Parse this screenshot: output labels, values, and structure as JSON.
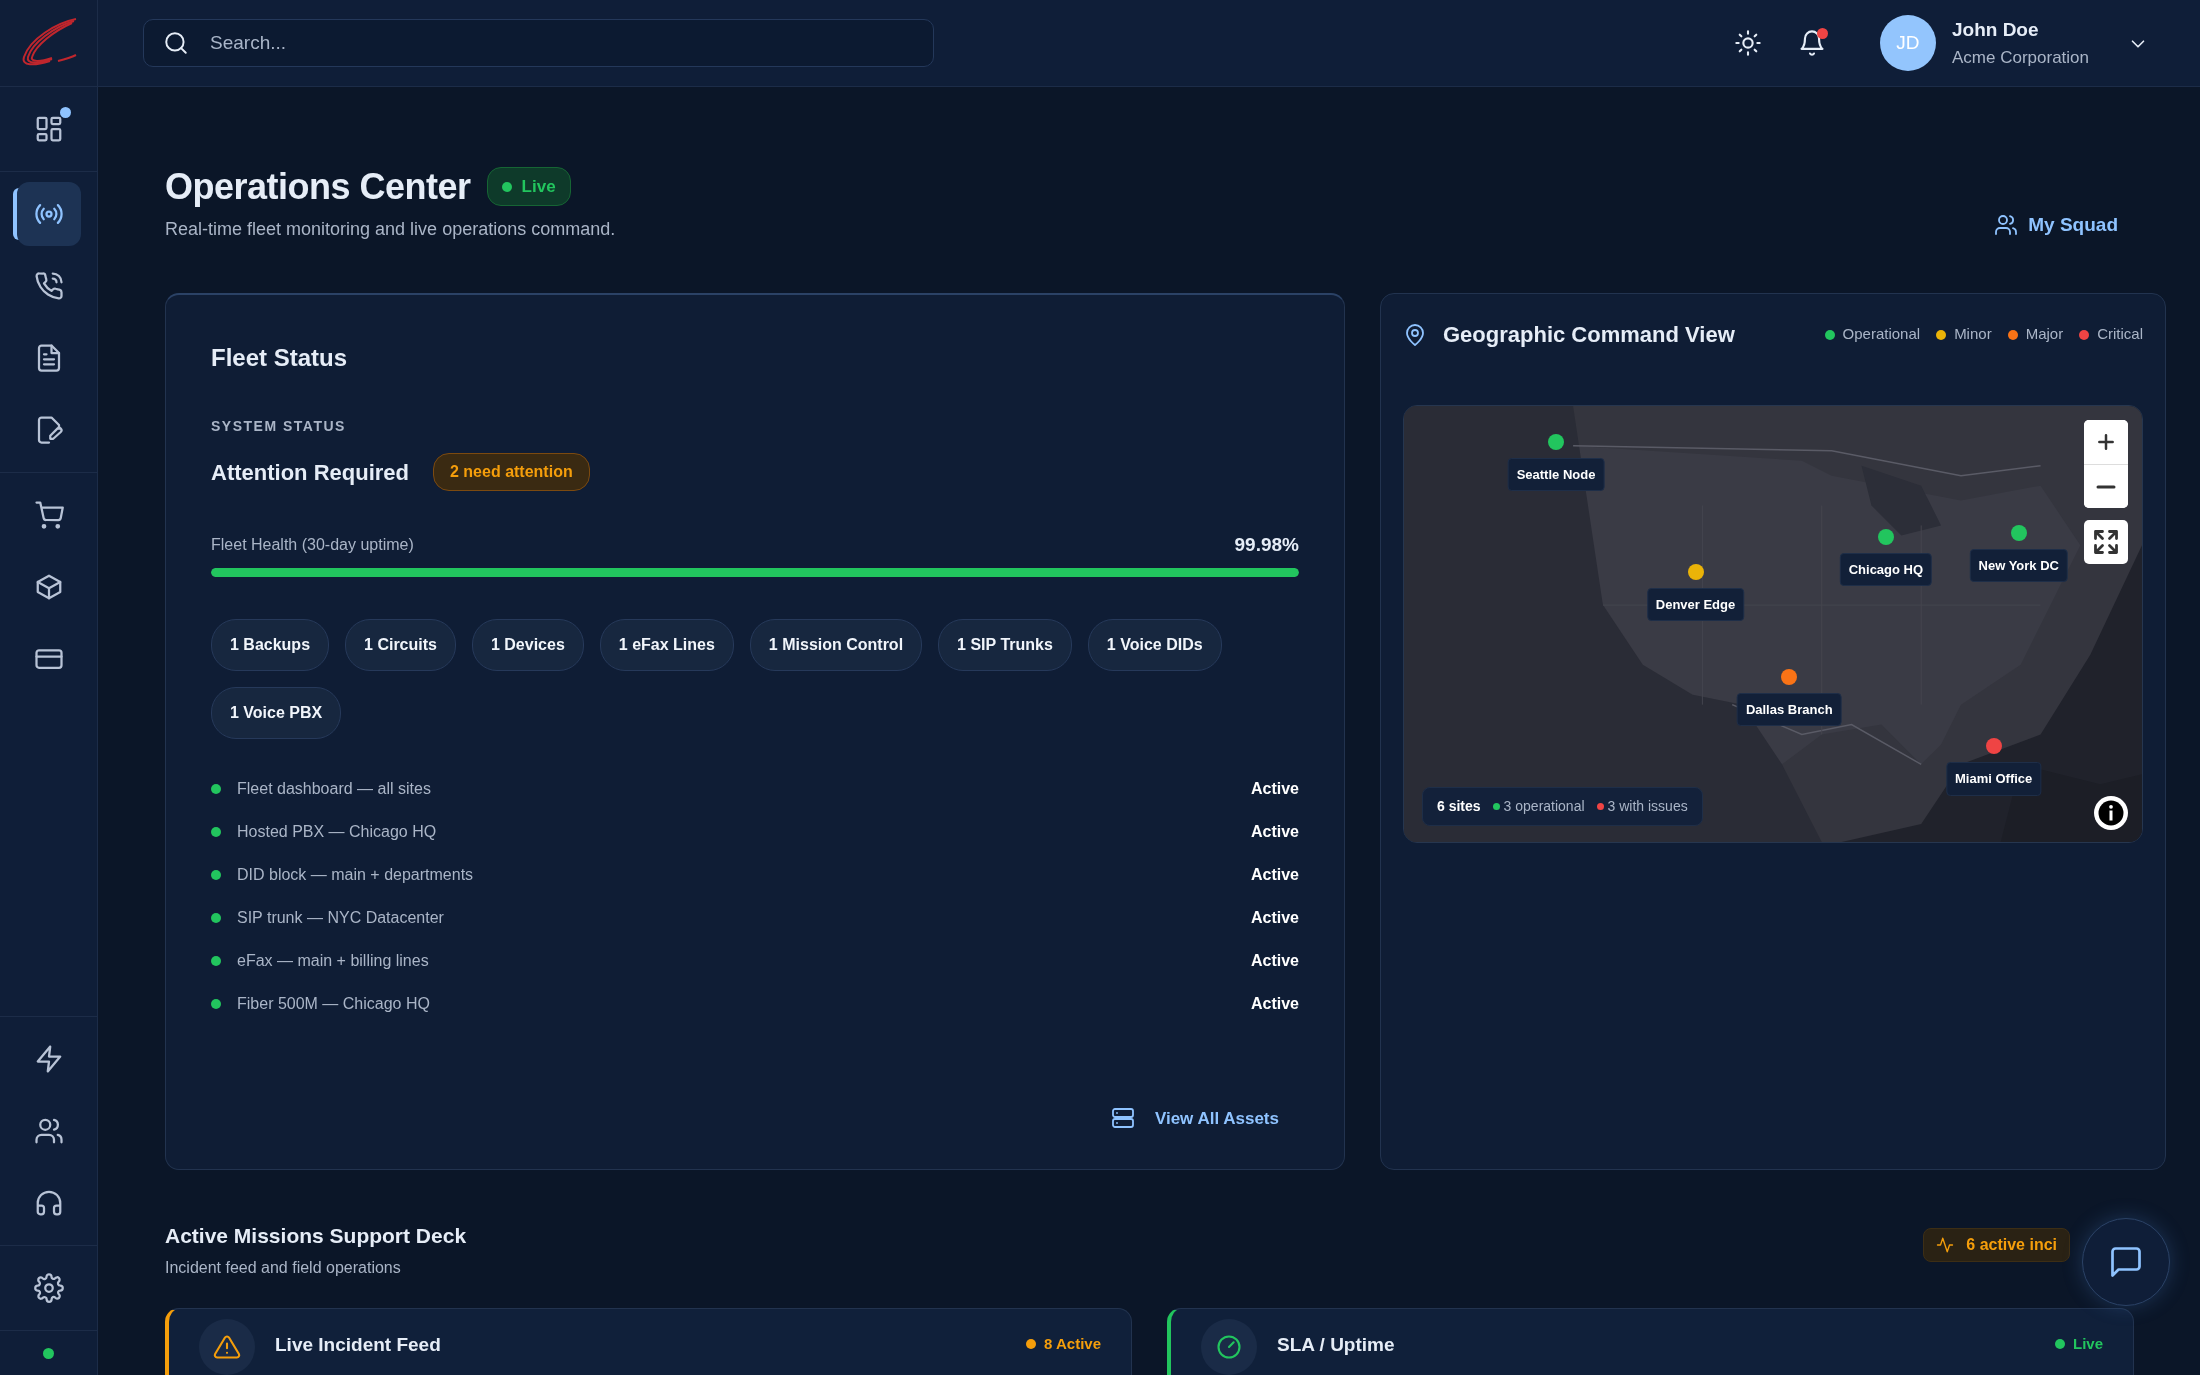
{
  "sidebar": {
    "top_groups": [
      {
        "items": [
          {
            "selected": false,
            "badge": true
          }
        ]
      },
      {
        "items": [
          {
            "selected": true,
            "badge": false
          },
          {
            "selected": false,
            "badge": false
          },
          {
            "selected": false,
            "badge": false
          },
          {
            "selected": false,
            "badge": false
          }
        ]
      },
      {
        "items": [
          {
            "selected": false,
            "badge": false
          },
          {
            "selected": false,
            "badge": false
          },
          {
            "selected": false,
            "badge": false
          }
        ]
      }
    ],
    "bottom_groups": [
      {
        "items": [
          {
            "selected": false,
            "badge": false
          },
          {
            "selected": false,
            "badge": false
          },
          {
            "selected": false,
            "badge": false
          }
        ]
      },
      {
        "items": [
          {
            "selected": false,
            "badge": false
          }
        ]
      }
    ],
    "status": {
      "color": "#22c55e"
    }
  },
  "header": {
    "search": {
      "placeholder": "Search..."
    },
    "notifications": {
      "unread": true
    },
    "user": {
      "initials": "JD",
      "name": "John Doe",
      "company": "Acme Corporation"
    }
  },
  "page": {
    "title": "Operations Center",
    "live_badge": "Live",
    "subtitle": "Real-time fleet monitoring and live operations command.",
    "squad_link": "My Squad"
  },
  "fleet": {
    "title": "Fleet Status",
    "section_label": "SYSTEM STATUS",
    "status": "Attention Required",
    "attention_badge": "2 need attention",
    "health": {
      "label": "Fleet Health (30-day uptime)",
      "reading": "99.98%",
      "level": 0.9998
    },
    "chips": [
      "1 Backups",
      "1 Circuits",
      "1 Devices",
      "1 eFax Lines",
      "1 Mission Control",
      "1 SIP Trunks",
      "1 Voice DIDs",
      "1 Voice PBX"
    ],
    "services": [
      {
        "name": "Fleet dashboard — all sites",
        "status": "Active",
        "color": "#22c55e"
      },
      {
        "name": "Hosted PBX — Chicago HQ",
        "status": "Active",
        "color": "#22c55e"
      },
      {
        "name": "DID block — main + departments",
        "status": "Active",
        "color": "#22c55e"
      },
      {
        "name": "SIP trunk — NYC Datacenter",
        "status": "Active",
        "color": "#22c55e"
      },
      {
        "name": "eFax — main + billing lines",
        "status": "Active",
        "color": "#22c55e"
      },
      {
        "name": "Fiber 500M — Chicago HQ",
        "status": "Active",
        "color": "#22c55e"
      }
    ],
    "link": "View All Assets"
  },
  "geo": {
    "title": "Geographic Command View",
    "legend": [
      {
        "label": "Operational",
        "color": "#22c55e"
      },
      {
        "label": "Minor",
        "color": "#eab308"
      },
      {
        "label": "Major",
        "color": "#f97316"
      },
      {
        "label": "Critical",
        "color": "#ef4444"
      }
    ],
    "map": {
      "kind": "picture",
      "sites": [
        {
          "name": "Seattle Node",
          "color": "#22c55e"
        },
        {
          "name": "Denver Edge",
          "color": "#eab308"
        },
        {
          "name": "Chicago HQ",
          "color": "#22c55e"
        },
        {
          "name": "New York DC",
          "color": "#22c55e"
        },
        {
          "name": "Dallas Branch",
          "color": "#f97316"
        },
        {
          "name": "Miami Office",
          "color": "#ef4444"
        }
      ],
      "summary": {
        "total": "6 sites",
        "parts": [
          {
            "label": "3 operational",
            "color": "#22c55e"
          },
          {
            "label": "3 with issues",
            "color": "#ef4444"
          }
        ]
      }
    }
  },
  "missions": {
    "title": "Active Missions Support Deck",
    "subtitle": "Incident feed and field operations",
    "badge": "6 active inci",
    "cards": [
      {
        "title": "Live Incident Feed",
        "status": "8 Active",
        "color": "#f59e0b"
      },
      {
        "title": "SLA / Uptime",
        "status": "Live",
        "color": "#22c55e"
      }
    ]
  }
}
